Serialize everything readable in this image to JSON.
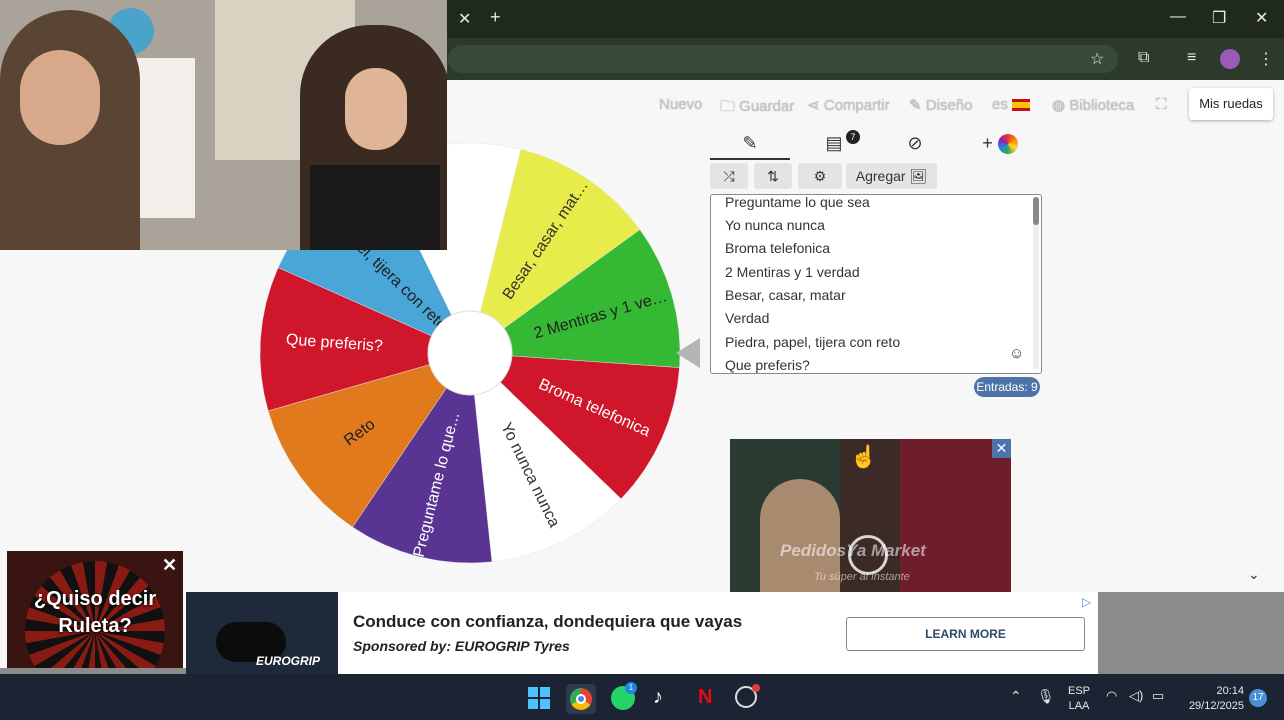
{
  "browser": {
    "tab_close": "✕",
    "new_tab": "+",
    "window_controls": [
      "—",
      "❐",
      "✕"
    ],
    "toolbar_icons": [
      "star-icon",
      "extensions-icon",
      "media-icon"
    ]
  },
  "app": {
    "nav": [
      {
        "label": "Nuevo",
        "icon": ""
      },
      {
        "label": "Guardar",
        "icon": "folder-icon"
      },
      {
        "label": "Compartir",
        "icon": "share-icon"
      },
      {
        "label": "Diseño",
        "icon": "pencil-icon"
      },
      {
        "label": "es",
        "icon": "spain-flag-icon"
      },
      {
        "label": "Biblioteca",
        "icon": "globe-icon"
      }
    ],
    "fullscreen_icon": "expand-icon",
    "my_wheels": "Mis ruedas"
  },
  "wheel": {
    "segments": [
      {
        "label": "Besar, casar, mat…",
        "color": "#e8ec4a",
        "text_color": "#333333"
      },
      {
        "label": "2 Mentiras y 1 ve…",
        "color": "#35b833",
        "text_color": "#1f1f1f"
      },
      {
        "label": "Broma telefonica",
        "color": "#d0162b",
        "text_color": "#ffffff"
      },
      {
        "label": "Yo nunca nunca",
        "color": "#ffffff",
        "text_color": "#333333"
      },
      {
        "label": "Preguntame lo que...",
        "color": "#5a3493",
        "text_color": "#ffffff"
      },
      {
        "label": "Reto",
        "color": "#e07a1d",
        "text_color": "#1f1f1f"
      },
      {
        "label": "Que preferis?",
        "color": "#d0162b",
        "text_color": "#ffffff"
      },
      {
        "label": "Piedra, papel, tijera con reto",
        "color": "#4aa6d6",
        "text_color": "#1f1f1f"
      },
      {
        "label": "",
        "color": "#ffffff",
        "text_color": "#333333"
      }
    ]
  },
  "panel": {
    "tabs": [
      {
        "name": "edit-tab",
        "icon": "pencil-icon",
        "glyph": "✎"
      },
      {
        "name": "results-tab",
        "icon": "clipboard-icon",
        "glyph": "📋",
        "badge": "7"
      },
      {
        "name": "hidden-tab",
        "icon": "eye-slash-icon",
        "glyph": "👁"
      },
      {
        "name": "add-wheel-tab",
        "icon": "color-wheel-icon",
        "glyph": "+"
      }
    ],
    "buttons": [
      {
        "label": "⤮",
        "icon": "shuffle-icon"
      },
      {
        "label": "⇅",
        "icon": "sort-icon"
      },
      {
        "label": "⚙",
        "icon": "settings-icon"
      },
      {
        "label": "Agregar 🖼",
        "icon": "image-icon"
      }
    ],
    "entries": [
      "Preguntame lo que sea",
      "Yo nunca nunca",
      "Broma telefonica",
      "2 Mentiras y 1 verdad",
      "Besar, casar, matar",
      "Verdad",
      "Piedra, papel, tijera con reto",
      "Que preferis?"
    ],
    "emoji_icon": "smiley-icon",
    "count_label": "Entradas: 9"
  },
  "video_ad": {
    "brand": "PedidosYa Market",
    "tagline": "Tu súper al instante",
    "close": "✕"
  },
  "casino_ad": {
    "line1": "¿Quiso decir",
    "line2": "Ruleta?",
    "close": "✕"
  },
  "banner_ad": {
    "title": "Conduce con confianza, dondequiera que vayas",
    "sponsor": "Sponsored by: EUROGRIP Tyres",
    "button": "LEARN MORE",
    "brand": "EUROGRIP"
  },
  "taskbar": {
    "apps": [
      "windows-icon",
      "chrome-icon",
      "whatsapp-icon",
      "tiktok-icon",
      "netflix-icon",
      "steam-icon"
    ],
    "whatsapp_badge": "1",
    "lang": "ESP",
    "layout": "LAA",
    "time": "20:14",
    "date": "29/12/2025",
    "notifications": "17"
  }
}
